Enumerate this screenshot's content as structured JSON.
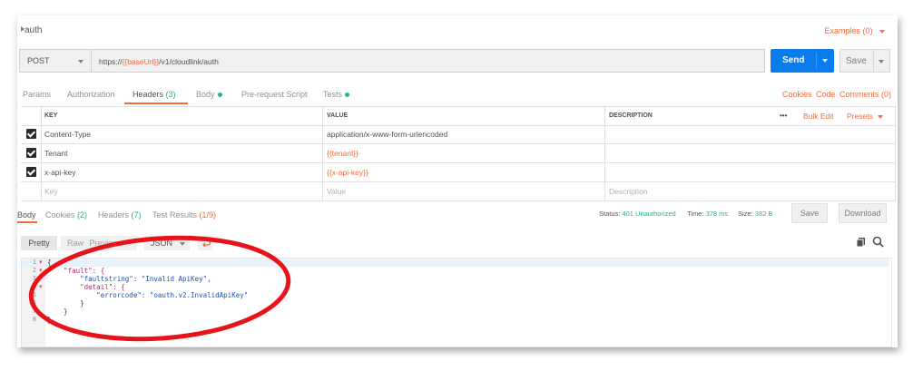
{
  "request": {
    "name": "auth",
    "examples_label": "Examples (0)",
    "method": "POST",
    "url_prefix": "https://",
    "url_var": "{{baseUrl}}",
    "url_suffix": "/v1/cloudlink/auth",
    "send_label": "Send",
    "save_label": "Save"
  },
  "request_tabs": {
    "params": "Params",
    "authorization": "Authorization",
    "headers": "Headers",
    "headers_count": "(3)",
    "body": "Body",
    "prerequest": "Pre-request Script",
    "tests": "Tests",
    "cookies": "Cookies",
    "code": "Code",
    "comments": "Comments (0)"
  },
  "headers_table": {
    "col_key": "KEY",
    "col_value": "VALUE",
    "col_description": "DESCRIPTION",
    "more": "•••",
    "bulk_edit": "Bulk Edit",
    "presets": "Presets",
    "rows": [
      {
        "key": "Content-Type",
        "value": "application/x-www-form-urlencoded",
        "value_is_var": false
      },
      {
        "key": "Tenant",
        "value": "{{tenant}}",
        "value_is_var": true
      },
      {
        "key": "x-api-key",
        "value": "{{x-api-key}}",
        "value_is_var": true
      }
    ],
    "placeholder_key": "Key",
    "placeholder_value": "Value",
    "placeholder_description": "Description"
  },
  "response_tabs": {
    "body": "Body",
    "cookies": "Cookies",
    "cookies_count": "(2)",
    "headers": "Headers",
    "headers_count": "(7)",
    "test_results": "Test Results",
    "test_results_count": "(1/9)"
  },
  "response_status": {
    "status_label": "Status:",
    "status_value": "401 Unauthorized",
    "time_label": "Time:",
    "time_value": "378 ms",
    "size_label": "Size:",
    "size_value": "382 B",
    "save": "Save",
    "download": "Download"
  },
  "view_bar": {
    "pretty": "Pretty",
    "raw": "Raw",
    "preview": "Preview",
    "format": "JSON"
  },
  "code_lines": [
    {
      "n": "1",
      "text": "{"
    },
    {
      "n": "2",
      "text": "    \"fault\": {"
    },
    {
      "n": "3",
      "text": "        \"faultstring\": \"Invalid ApiKey\","
    },
    {
      "n": "4",
      "text": "        \"detail\": {"
    },
    {
      "n": "5",
      "text": "            \"errorcode\": \"oauth.v2.InvalidApiKey\""
    },
    {
      "n": "6",
      "text": "        }"
    },
    {
      "n": "7",
      "text": "    }"
    },
    {
      "n": "8",
      "text": "}"
    }
  ],
  "colors": {
    "accent": "#f26b3a",
    "send_blue": "#097bed",
    "success_green": "#26b47f",
    "annotation_red": "#e8121a"
  }
}
